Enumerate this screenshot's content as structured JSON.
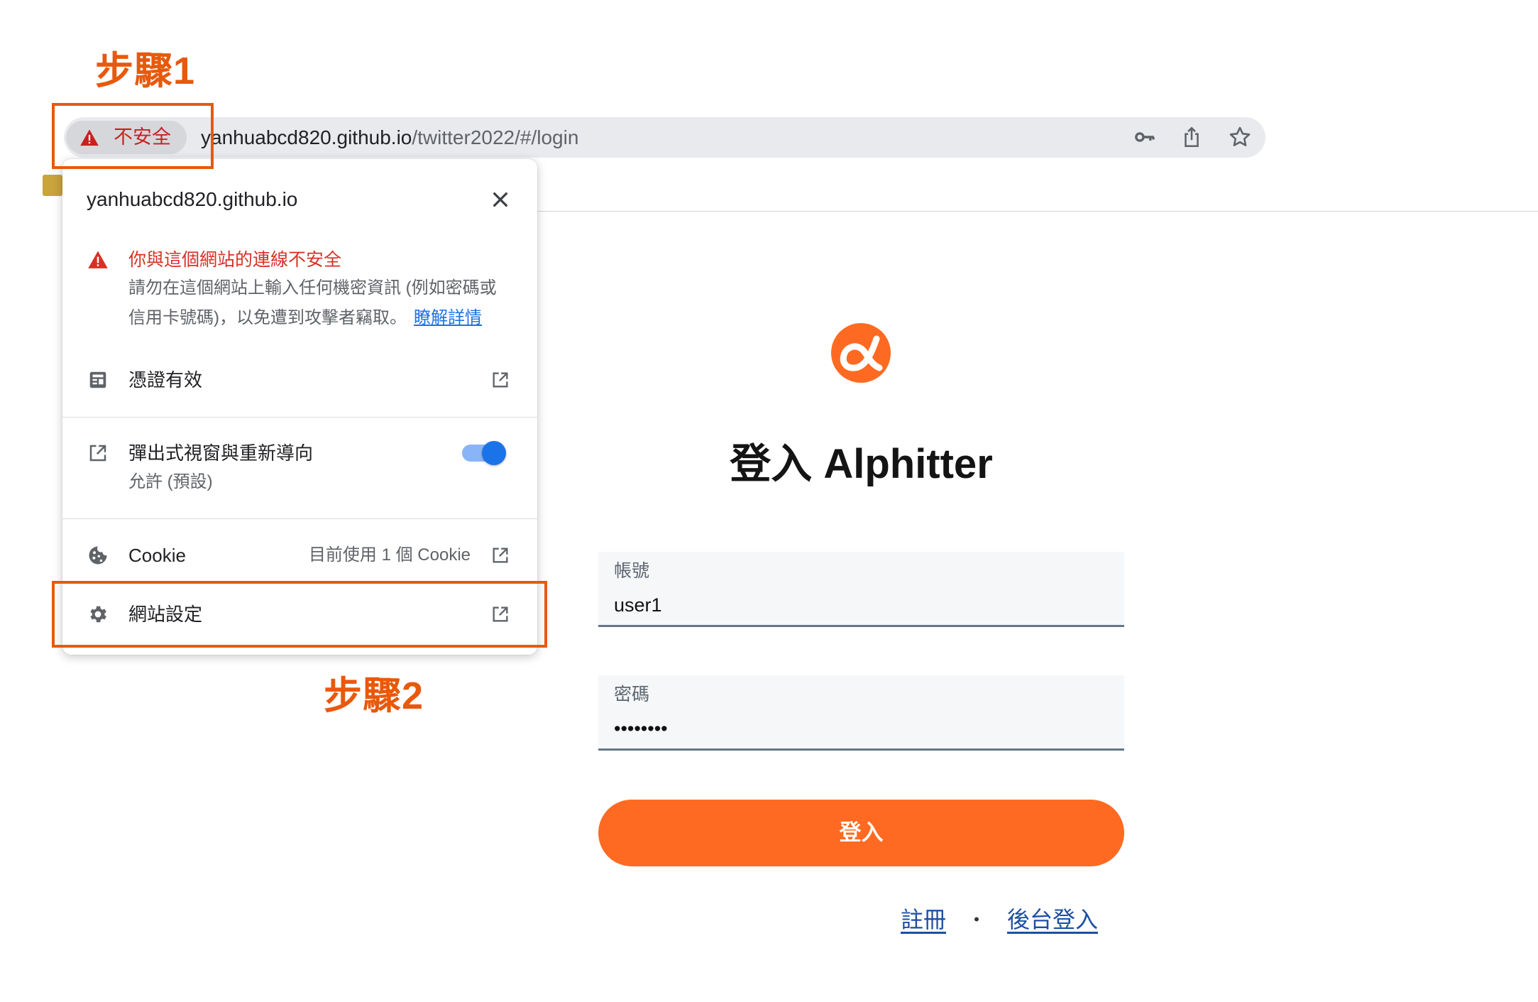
{
  "annotations": {
    "step1": "步驟1",
    "step2": "步驟2",
    "color": "#e8590c"
  },
  "browser": {
    "security_label": "不安全",
    "url_host": "yanhuabcd820.github.io",
    "url_path": "/twitter2022/#/login",
    "icons": [
      "warning-icon",
      "key-icon",
      "share-icon",
      "star-icon"
    ]
  },
  "site_info_popup": {
    "host": "yanhuabcd820.github.io",
    "warning_title": "你與這個網站的連線不安全",
    "warning_line1": "請勿在這個網站上輸入任何機密資訊 (例如密碼或",
    "warning_line2": "信用卡號碼)，以免遭到攻擊者竊取。",
    "learn_more": "瞭解詳情",
    "certificate_label": "憑證有效",
    "popups_label": "彈出式視窗與重新導向",
    "popups_status": "允許 (預設)",
    "popups_toggle_on": true,
    "cookie_label": "Cookie",
    "cookie_status": "目前使用 1 個 Cookie",
    "site_settings_label": "網站設定",
    "icons": [
      "close-icon",
      "warning-icon",
      "certificate-icon",
      "open-in-new-icon",
      "cookie-icon",
      "gear-icon",
      "external-link-icon"
    ]
  },
  "login": {
    "title": "登入 Alphitter",
    "username_label": "帳號",
    "username_value": "user1",
    "password_label": "密碼",
    "password_value": "••••••••",
    "submit_label": "登入",
    "separator": "•",
    "register_link": "註冊",
    "admin_login_link": "後台登入",
    "brand_color": "#ff6a22",
    "link_color": "#1d4fa3"
  }
}
